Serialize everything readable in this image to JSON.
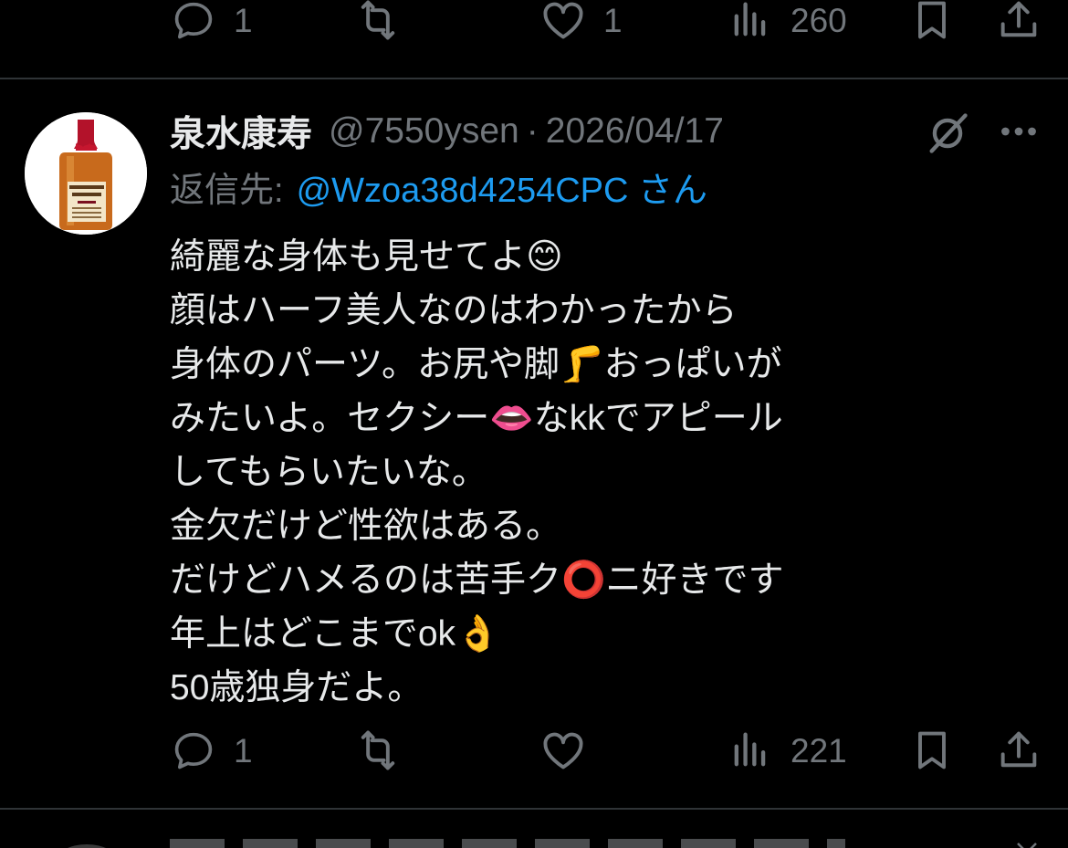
{
  "colors": {
    "background": "#000000",
    "primary_text": "#e7e9ea",
    "secondary_text": "#71767b",
    "link": "#1d9bf0",
    "divider": "#2f3336"
  },
  "top_action_bar": {
    "reply_count": "1",
    "repost_count": "",
    "like_count": "1",
    "view_count": "260"
  },
  "post": {
    "avatar_icon": "whisky-bottle-avatar",
    "display_name": "泉水康寿",
    "handle": "@7550ysen",
    "separator": "·",
    "date": "2026/04/17",
    "reply_prefix": "返信先:",
    "reply_target": "@Wzoa38d4254CPC さん",
    "body_lines": [
      "綺麗な身体も見せてよ😊",
      "顔はハーフ美人なのはわかったから",
      "身体のパーツ。お尻や脚🦵おっぱいが",
      "みたいよ。セクシー👄なkkでアピール",
      "してもらいたいな。",
      "金欠だけど性欲はある。",
      "だけどハメるのは苦手ク⭕️ニ好きです",
      "年上はどこまでok👌",
      "50歳独身だよ。"
    ],
    "actions": {
      "reply_count": "1",
      "repost_count": "",
      "like_count": "",
      "view_count": "221"
    }
  },
  "icons": {
    "reply": "speech-bubble-icon",
    "repost": "repost-arrows-icon",
    "like": "heart-icon",
    "views": "bar-chart-icon",
    "bookmark": "bookmark-icon",
    "share": "share-upload-icon",
    "grok": "grok-slash-icon",
    "more": "more-dots-icon"
  }
}
